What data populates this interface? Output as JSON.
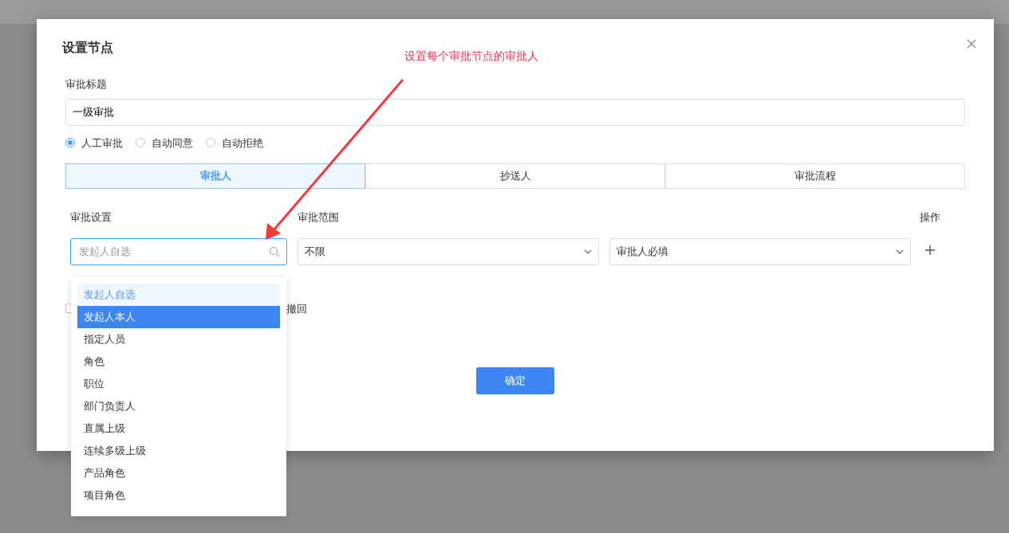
{
  "dialog": {
    "title": "设置节点"
  },
  "annotation": {
    "text": "设置每个审批节点的审批人"
  },
  "title_field": {
    "label": "审批标题",
    "value": "一级审批"
  },
  "approval_modes": [
    {
      "label": "人工审批",
      "selected": true
    },
    {
      "label": "自动同意",
      "selected": false
    },
    {
      "label": "自动拒绝",
      "selected": false
    }
  ],
  "tabs": [
    {
      "label": "审批人",
      "selected": true
    },
    {
      "label": "抄送人",
      "selected": false
    },
    {
      "label": "审批流程",
      "selected": false
    }
  ],
  "columns": [
    "审批设置",
    "审批范围",
    "操作"
  ],
  "rule_row": {
    "setting": {
      "placeholder": "发起人自选"
    },
    "scope": "不限",
    "requirement": "审批人必填"
  },
  "dropdown_options": [
    {
      "label": "发起人自选",
      "selected": true,
      "hovered": false
    },
    {
      "label": "发起人本人",
      "selected": false,
      "hovered": true
    },
    {
      "label": "指定人员",
      "selected": false,
      "hovered": false
    },
    {
      "label": "角色",
      "selected": false,
      "hovered": false
    },
    {
      "label": "职位",
      "selected": false,
      "hovered": false
    },
    {
      "label": "部门负责人",
      "selected": false,
      "hovered": false
    },
    {
      "label": "直属上级",
      "selected": false,
      "hovered": false
    },
    {
      "label": "连续多级上级",
      "selected": false,
      "hovered": false
    },
    {
      "label": "产品角色",
      "selected": false,
      "hovered": false
    },
    {
      "label": "项目角色",
      "selected": false,
      "hovered": false
    }
  ],
  "withdraw_option": {
    "label": "撤回",
    "checked": false
  },
  "confirm_button": "确定"
}
